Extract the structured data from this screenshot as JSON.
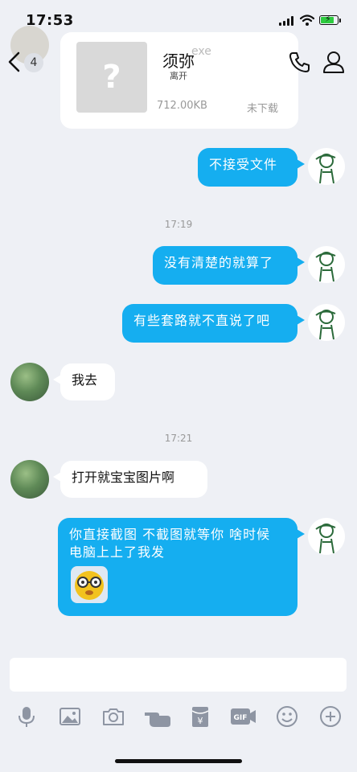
{
  "status_bar": {
    "time": "17:53"
  },
  "header": {
    "contact_name": "须弥",
    "contact_status": "离开",
    "unread_count": "4"
  },
  "file_card": {
    "size": "712.00KB",
    "status": "未下载",
    "filename_partial": "exe"
  },
  "messages": [
    {
      "kind": "out",
      "text": "不接受文件"
    },
    {
      "kind": "timestamp",
      "text": "17:19"
    },
    {
      "kind": "out",
      "text": "没有清楚的就算了"
    },
    {
      "kind": "out",
      "text": "有些套路就不直说了吧"
    },
    {
      "kind": "in",
      "text": "我去"
    },
    {
      "kind": "timestamp",
      "text": "17:21"
    },
    {
      "kind": "in",
      "text": "打开就宝宝图片啊"
    },
    {
      "kind": "out",
      "text": "你直接截图   不截图就等你 啥时候电脑上上了我发",
      "sticker": "glasses-face-sticker"
    }
  ],
  "toolbar_icons": [
    "microphone-icon",
    "image-icon",
    "camera-icon",
    "hand-point-icon",
    "red-packet-icon",
    "gif-icon",
    "emoji-icon",
    "plus-icon"
  ],
  "colors": {
    "outgoing_bubble": "#15aef0",
    "incoming_bubble": "#ffffff",
    "background": "#eef0f5"
  }
}
